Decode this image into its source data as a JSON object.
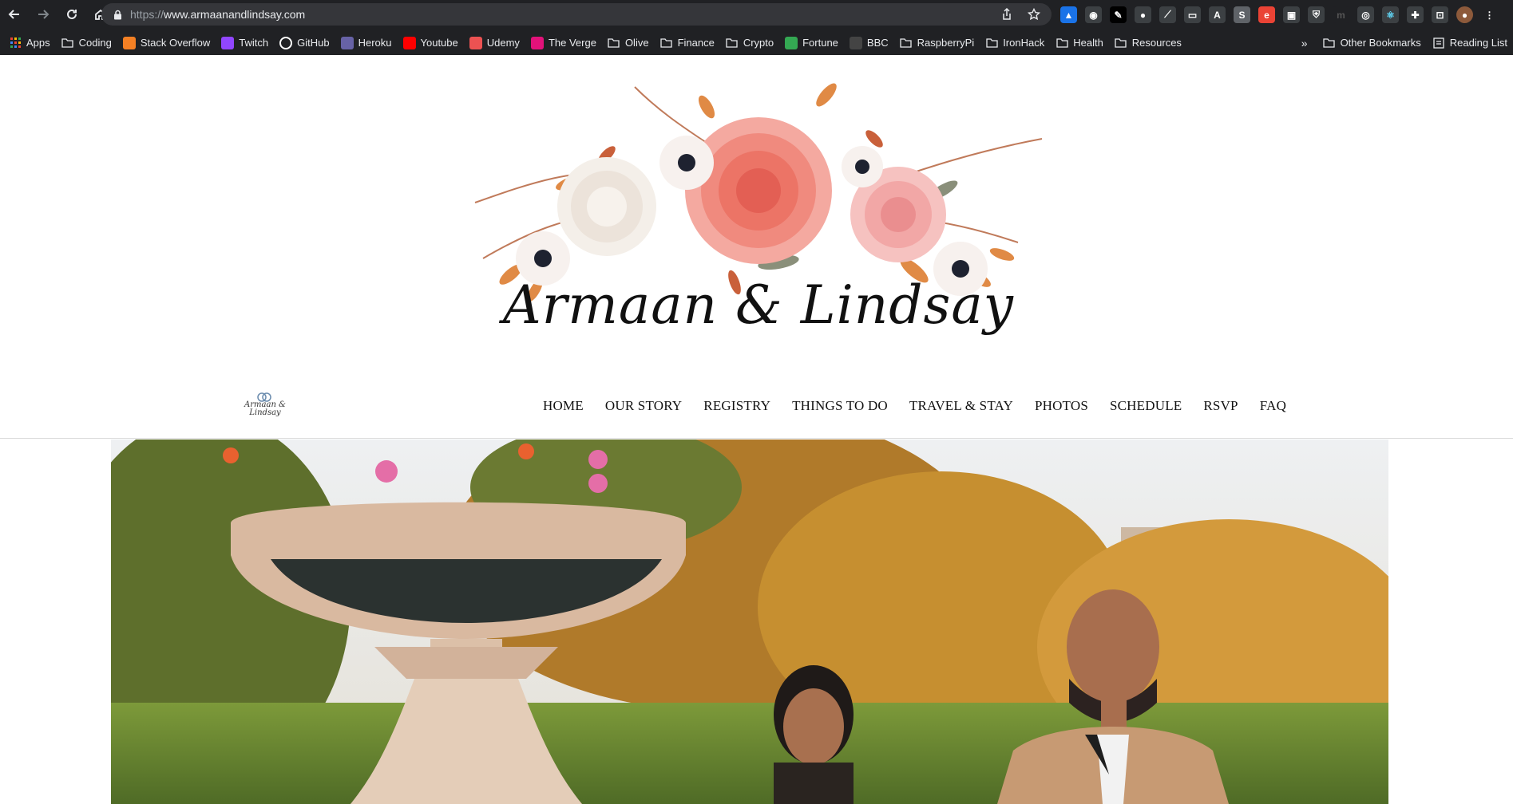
{
  "browser": {
    "url_scheme": "https://",
    "url_host": "www.armaanandlindsay.com",
    "bookmarks": [
      {
        "label": "Apps",
        "icon": "apps-grid-icon",
        "color": "#ea4335"
      },
      {
        "label": "Coding",
        "icon": "folder-icon",
        "color": "#9aa0a6"
      },
      {
        "label": "Stack Overflow",
        "icon": "stackoverflow-icon",
        "color": "#f48024"
      },
      {
        "label": "Twitch",
        "icon": "twitch-icon",
        "color": "#9146ff"
      },
      {
        "label": "GitHub",
        "icon": "github-icon",
        "color": "#ffffff"
      },
      {
        "label": "Heroku",
        "icon": "heroku-icon",
        "color": "#6762a6"
      },
      {
        "label": "Youtube",
        "icon": "youtube-icon",
        "color": "#ff0000"
      },
      {
        "label": "Udemy",
        "icon": "udemy-icon",
        "color": "#ec5252"
      },
      {
        "label": "The Verge",
        "icon": "verge-icon",
        "color": "#e2127a"
      },
      {
        "label": "Olive",
        "icon": "folder-icon",
        "color": "#9aa0a6"
      },
      {
        "label": "Finance",
        "icon": "folder-icon",
        "color": "#9aa0a6"
      },
      {
        "label": "Crypto",
        "icon": "folder-icon",
        "color": "#9aa0a6"
      },
      {
        "label": "Fortune",
        "icon": "fortune-icon",
        "color": "#34a853"
      },
      {
        "label": "BBC",
        "icon": "bbc-icon",
        "color": "#444444"
      },
      {
        "label": "RaspberryPi",
        "icon": "folder-icon",
        "color": "#9aa0a6"
      },
      {
        "label": "IronHack",
        "icon": "folder-icon",
        "color": "#9aa0a6"
      },
      {
        "label": "Health",
        "icon": "folder-icon",
        "color": "#9aa0a6"
      },
      {
        "label": "Resources",
        "icon": "folder-icon",
        "color": "#9aa0a6"
      }
    ],
    "other_bookmarks": "Other Bookmarks",
    "reading_list": "Reading List",
    "overflow": "»"
  },
  "site": {
    "logo_title": "Armaan & Lindsay",
    "mini_logo_text": "Armaan & Lindsay",
    "nav": [
      "HOME",
      "OUR STORY",
      "REGISTRY",
      "THINGS TO DO",
      "TRAVEL & STAY",
      "PHOTOS",
      "SCHEDULE",
      "RSVP",
      "FAQ"
    ]
  },
  "colors": {
    "chrome_bg": "#202124",
    "omnibox_bg": "#35363a",
    "rose": "#f08a7e",
    "blush": "#f6b8b4",
    "autumn": "#d98a3c"
  }
}
